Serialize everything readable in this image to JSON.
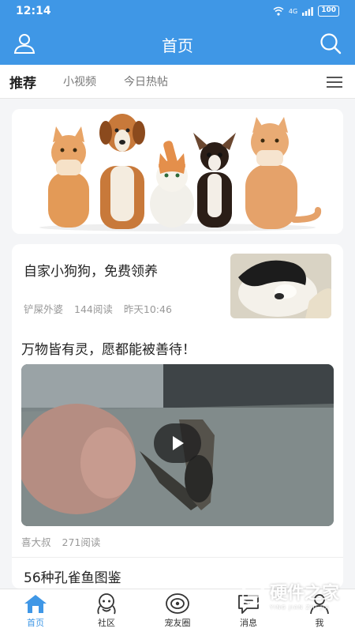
{
  "status": {
    "time": "12:14",
    "signal": "4G",
    "battery": "100"
  },
  "header": {
    "title": "首页"
  },
  "tabs": [
    {
      "label": "推荐",
      "active": true
    },
    {
      "label": "小视频",
      "active": false
    },
    {
      "label": "今日热帖",
      "active": false
    }
  ],
  "feed": {
    "post1": {
      "title": "自家小狗狗，免费领养",
      "author": "铲屎外婆",
      "reads": "144阅读",
      "time": "昨天10:46"
    },
    "post2": {
      "title": "万物皆有灵，愿都能被善待！",
      "author": "喜大叔",
      "reads": "271阅读"
    },
    "post3": {
      "title": "56种孔雀鱼图鉴"
    }
  },
  "bottom_nav": [
    {
      "label": "首页",
      "icon": "home-icon",
      "active": true
    },
    {
      "label": "社区",
      "icon": "community-icon",
      "active": false
    },
    {
      "label": "宠友圈",
      "icon": "pet-circle-icon",
      "active": false
    },
    {
      "label": "消息",
      "icon": "message-icon",
      "active": false
    },
    {
      "label": "我",
      "icon": "profile-icon",
      "active": false
    }
  ],
  "watermark": {
    "text": "硬件之家",
    "sub": "YING JIAN ZHI JIA"
  },
  "colors": {
    "primary": "#3f97e6",
    "background": "#f4f5f7",
    "text": "#222222",
    "muted": "#999999"
  }
}
